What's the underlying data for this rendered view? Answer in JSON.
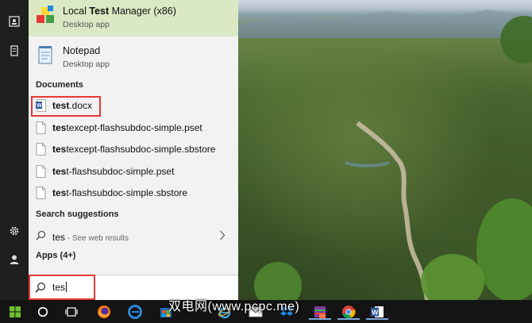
{
  "panel": {
    "best_match": {
      "title_prefix": "Local ",
      "title_bold": "Test",
      "title_suffix": " Manager (x86)",
      "subtitle": "Desktop app",
      "icon": "test-manager-cubes-icon"
    },
    "apps": [
      {
        "title": "Notepad",
        "subtitle": "Desktop app",
        "icon": "notepad-icon"
      }
    ],
    "documents_header": "Documents",
    "documents": [
      {
        "bold": "test",
        "rest": ".docx",
        "icon": "word-doc-icon"
      },
      {
        "bold": "tes",
        "rest": "texcept-flashsubdoc-simple.pset",
        "icon": "file-icon"
      },
      {
        "bold": "tes",
        "rest": "texcept-flashsubdoc-simple.sbstore",
        "icon": "file-icon"
      },
      {
        "bold": "tes",
        "rest": "t-flashsubdoc-simple.pset",
        "icon": "file-icon"
      },
      {
        "bold": "tes",
        "rest": "t-flashsubdoc-simple.sbstore",
        "icon": "file-icon"
      }
    ],
    "suggestions_header": "Search suggestions",
    "suggestion": {
      "term": "tes",
      "hint": " - See web results"
    },
    "apps_header": "Apps (4+)",
    "search": {
      "value": "tes"
    }
  },
  "rail": {
    "icons": [
      "contact-card-icon",
      "tablet-icon",
      "settings-gear-icon",
      "user-account-icon"
    ]
  },
  "taskbar": {
    "icons": [
      "windows-start-icon",
      "cortana-circle-icon",
      "task-view-icon",
      "firefox-icon",
      "edge-icon",
      "store-icon",
      "internet-explorer-icon",
      "mail-icon",
      "dropbox-icon",
      "winrar-icon",
      "chrome-icon",
      "word-icon"
    ]
  },
  "watermark": "双电网(www.pcpc.me)",
  "colors": {
    "best_match_bg": "#dbe8c4",
    "panel_bg": "#f2f2f2",
    "highlight": "#e53935",
    "taskbar": "#141414"
  }
}
